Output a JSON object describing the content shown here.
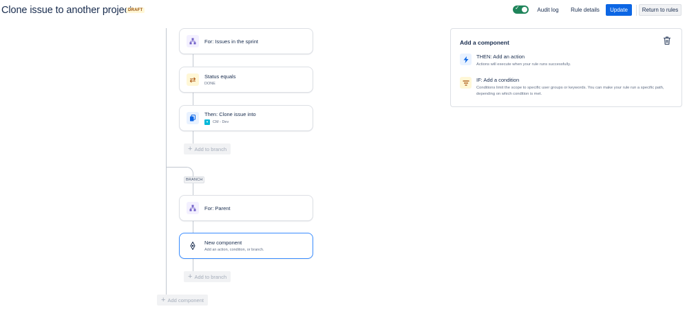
{
  "header": {
    "title": "Clone issue to another project",
    "status_badge": "DRAFT",
    "toggle_on": true,
    "audit_log_label": "Audit log",
    "rule_details_label": "Rule details",
    "update_label": "Update",
    "return_label": "Return to rules"
  },
  "flow": {
    "cards": [
      {
        "title": "For: Issues in the sprint",
        "subtitle": "",
        "icon": "branch-icon"
      },
      {
        "title": "Status equals",
        "subtitle": "DONE",
        "icon": "shuffle-icon"
      },
      {
        "title": "Then: Clone issue into",
        "subtitle": "CM - Dev",
        "icon": "copy-icon"
      },
      {
        "title": "For: Parent",
        "subtitle": "",
        "icon": "branch-icon"
      },
      {
        "title": "New component",
        "subtitle": "Add an action, condition, or branch.",
        "icon": "diamond-icon"
      }
    ],
    "add_to_branch_label": "Add to branch",
    "branch_label": "BRANCH",
    "add_component_label": "Add component"
  },
  "panel": {
    "title": "Add a component",
    "options": [
      {
        "title": "THEN: Add an action",
        "desc": "Actions will execute when your rule runs successfully.",
        "icon": "lightning-icon"
      },
      {
        "title": "IF: Add a condition",
        "desc": "Conditions limit the scope to specific user groups or keywords. You can make your rule run a specific path, depending on which condition is met.",
        "icon": "filter-icon"
      }
    ]
  },
  "colors": {
    "primary": "#0c66e4",
    "toggle_on": "#1f845a",
    "selected_border": "#388bff"
  }
}
